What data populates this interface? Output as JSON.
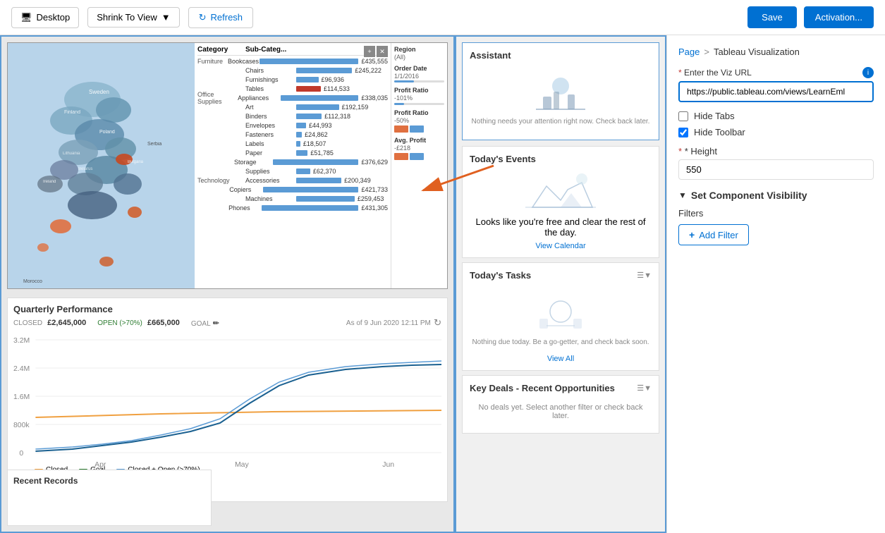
{
  "topbar": {
    "desktop_label": "Desktop",
    "shrink_label": "Shrink To View",
    "refresh_label": "Refresh",
    "save_label": "Save",
    "activation_label": "Activation..."
  },
  "tableau": {
    "url_label": "* Enter the Viz URL",
    "url_value": "https://public.tableau.com/views/LearnEml",
    "hide_tabs_label": "Hide Tabs",
    "hide_toolbar_label": "Hide Toolbar",
    "height_label": "* Height",
    "height_value": "550"
  },
  "breadcrumb": {
    "page": "Page",
    "separator": ">",
    "current": "Tableau Visualization"
  },
  "set_component": {
    "title": "Set Component Visibility",
    "filters_label": "Filters",
    "add_filter_label": "Add Filter"
  },
  "data_table": {
    "headers": [
      "Category",
      "Sub-Categ...",
      ""
    ],
    "rows": [
      {
        "cat": "Furniture",
        "subcat": "Bookcases",
        "value": "£435,555",
        "bar": 120,
        "type": "blue"
      },
      {
        "cat": "",
        "subcat": "Chairs",
        "value": "£245,222",
        "bar": 68,
        "type": "blue"
      },
      {
        "cat": "",
        "subcat": "Furnishings",
        "value": "£96,936",
        "bar": 27,
        "type": "blue"
      },
      {
        "cat": "",
        "subcat": "Tables",
        "value": "£114,533",
        "bar": 30,
        "type": "red"
      },
      {
        "cat": "Office Supplies",
        "subcat": "Appliances",
        "value": "£338,035",
        "bar": 95,
        "type": "blue"
      },
      {
        "cat": "",
        "subcat": "Art",
        "value": "£192,159",
        "bar": 52,
        "type": "blue"
      },
      {
        "cat": "",
        "subcat": "Binders",
        "value": "£112,318",
        "bar": 31,
        "type": "blue"
      },
      {
        "cat": "",
        "subcat": "Envelopes",
        "value": "£44,993",
        "bar": 12,
        "type": "blue"
      },
      {
        "cat": "",
        "subcat": "Fasteners",
        "value": "£24,862",
        "bar": 7,
        "type": "blue"
      },
      {
        "cat": "",
        "subcat": "Labels",
        "value": "£18,507",
        "bar": 5,
        "type": "blue"
      },
      {
        "cat": "",
        "subcat": "Paper",
        "value": "£51,785",
        "bar": 14,
        "type": "blue"
      },
      {
        "cat": "",
        "subcat": "Storage",
        "value": "£376,629",
        "bar": 104,
        "type": "blue"
      },
      {
        "cat": "",
        "subcat": "Supplies",
        "value": "£62,370",
        "bar": 17,
        "type": "blue"
      },
      {
        "cat": "Technology",
        "subcat": "Accessories",
        "value": "£200,349",
        "bar": 55,
        "type": "blue"
      },
      {
        "cat": "",
        "subcat": "Copiers",
        "value": "£421,733",
        "bar": 116,
        "type": "blue"
      },
      {
        "cat": "",
        "subcat": "Machines",
        "value": "£259,453",
        "bar": 71,
        "type": "blue"
      },
      {
        "cat": "",
        "subcat": "Phones",
        "value": "£431,305",
        "bar": 118,
        "type": "blue"
      }
    ]
  },
  "side_filters": {
    "region_label": "Region",
    "region_val": "(All)",
    "order_date_label": "Order Date",
    "order_date_val": "1/1/2016",
    "profit_ratio_label": "Profit Ratio",
    "profit_ratio_val": "-101%",
    "profit_ratio2_label": "Profit Ratio",
    "profit_ratio2_val": "-50%",
    "avg_profit_label": "Avg. Profit",
    "avg_profit_val": "-£218"
  },
  "quarterly": {
    "title": "Quarterly Performance",
    "closed_label": "CLOSED",
    "closed_val": "£2,645,000",
    "open_label": "OPEN (>70%)",
    "open_val": "£665,000",
    "goal_label": "GOAL",
    "as_of": "As of 9 Jun 2020 12:11 PM",
    "y_labels": [
      "3.2M",
      "2.4M",
      "1.6M",
      "800k",
      "0"
    ],
    "x_labels": [
      "Apr",
      "May",
      "Jun"
    ],
    "legend": [
      "Closed",
      "Goal",
      "Closed + Open (>70%)"
    ]
  },
  "assistant": {
    "title": "Assistant",
    "text": "Nothing needs your attention right now. Check back later."
  },
  "today_events": {
    "title": "Today's Events",
    "text": "Looks like you're free and clear the rest of the day.",
    "view_link": "View Calendar"
  },
  "today_tasks": {
    "title": "Today's Tasks",
    "text": "Nothing due today. Be a go-getter, and check back soon.",
    "view_link": "View All"
  },
  "key_deals": {
    "title": "Key Deals - Recent Opportunities",
    "text": "No deals yet. Select another filter or check back later."
  },
  "recent_records": {
    "title": "Recent Records"
  }
}
